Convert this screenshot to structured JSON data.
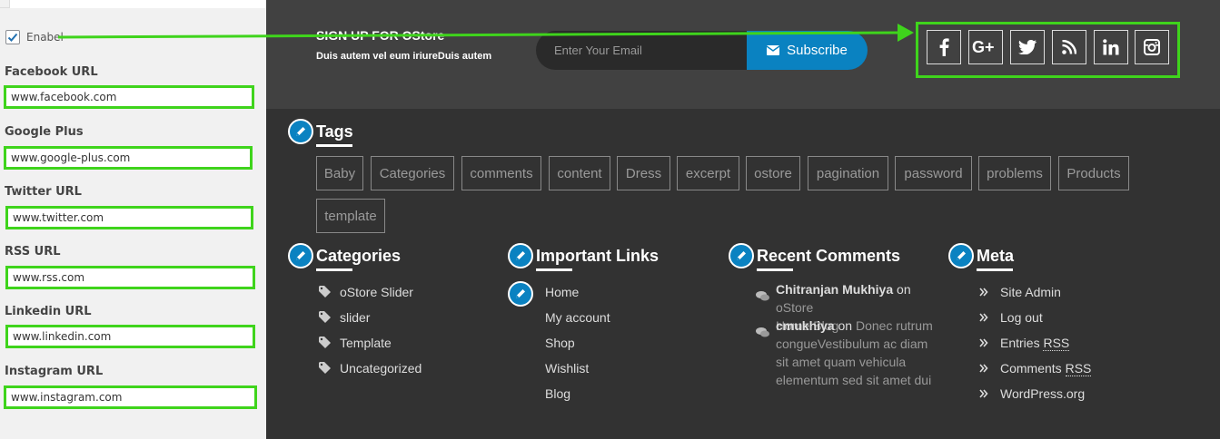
{
  "left_panel": {
    "enable_label": "Enabel",
    "fields": [
      {
        "label": "Facebook URL",
        "value": "www.facebook.com"
      },
      {
        "label": "Google Plus",
        "value": "www.google-plus.com"
      },
      {
        "label": "Twitter URL",
        "value": "www.twitter.com"
      },
      {
        "label": "RSS URL",
        "value": "www.rss.com"
      },
      {
        "label": "Linkedin URL",
        "value": "www.linkedin.com"
      },
      {
        "label": "Instagram URL",
        "value": "www.instagram.com"
      }
    ]
  },
  "signup": {
    "title": "SIGN UP FOR OStore",
    "subtitle": "Duis autem vel eum iriureDuis autem",
    "email_placeholder": "Enter Your Email",
    "subscribe_label": "Subscribe"
  },
  "social_icons": [
    "facebook-icon",
    "google-plus-icon",
    "twitter-icon",
    "rss-icon",
    "linkedin-icon",
    "instagram-icon"
  ],
  "tags": {
    "title": "Tags",
    "items": [
      "Baby",
      "Categories",
      "comments",
      "content",
      "Dress",
      "excerpt",
      "ostore",
      "pagination",
      "password",
      "problems",
      "Products",
      "template"
    ]
  },
  "categories": {
    "title": "Categories",
    "items": [
      "oStore Slider",
      "slider",
      "Template",
      "Uncategorized"
    ]
  },
  "important_links": {
    "title": "Important Links",
    "items": [
      "Home",
      "My account",
      "Shop",
      "Wishlist",
      "Blog"
    ]
  },
  "recent_comments": {
    "title": "Recent Comments",
    "items": [
      {
        "author": "Chitranjan Mukhiya",
        "on": "on",
        "post_line1": "oStore",
        "post_line2": "Home Blog"
      },
      {
        "author": "cmukhiya",
        "on": "on",
        "post_line1": "Donec rutrum",
        "post_line2": "congueVestibulum ac diam",
        "post_line3": "sit amet quam vehicula",
        "post_line4": "elementum sed sit amet dui"
      }
    ]
  },
  "meta": {
    "title": "Meta",
    "items": [
      "Site Admin",
      "Log out",
      "Entries RSS",
      "Comments RSS",
      "WordPress.org"
    ]
  },
  "colors": {
    "accent_blue": "#0a82c1",
    "highlight_green": "#3fd41c",
    "top_band": "#414141",
    "bottom_band": "#323232"
  }
}
